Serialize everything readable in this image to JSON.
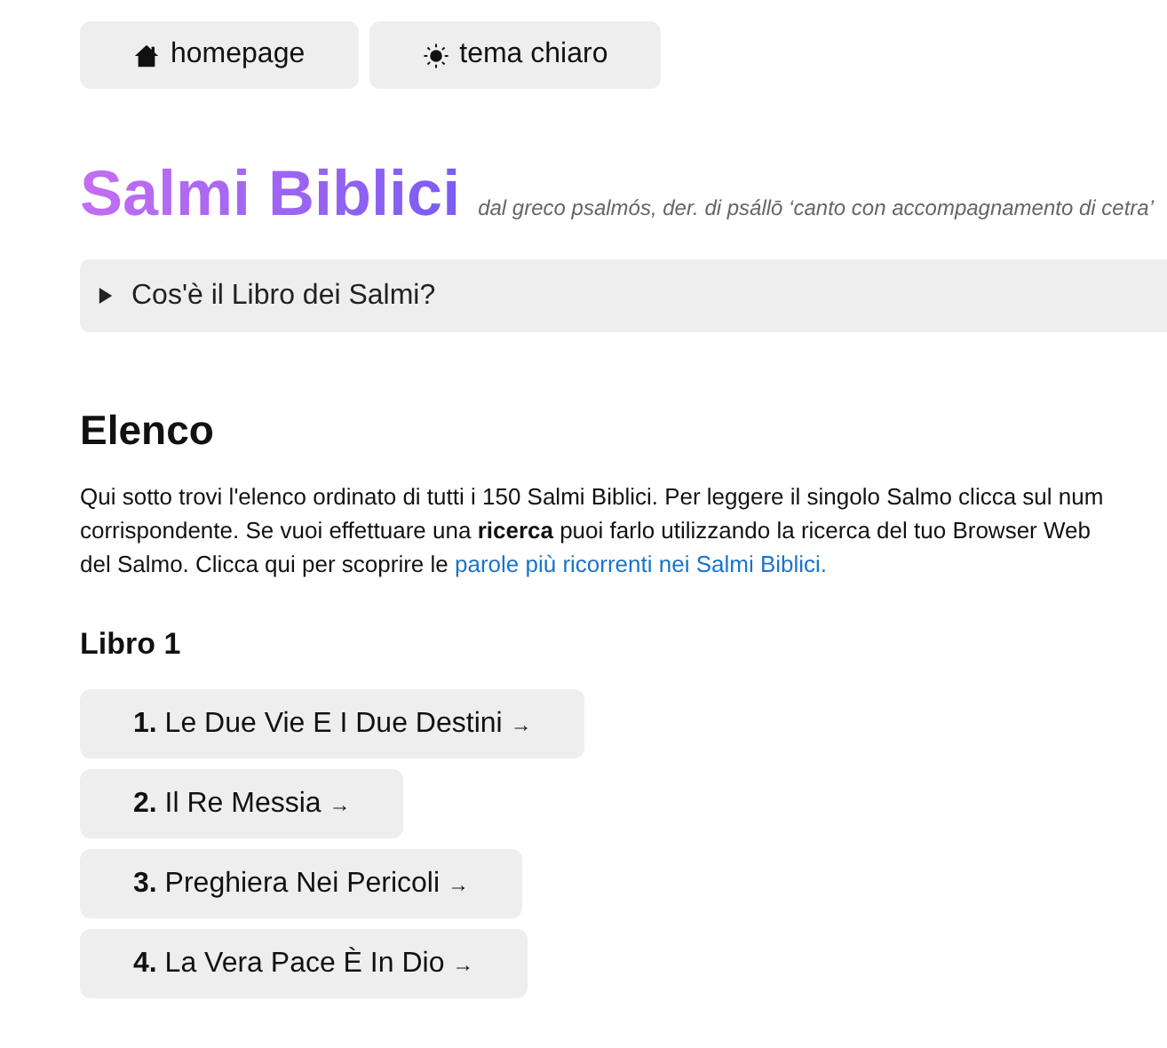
{
  "nav": [
    {
      "kind": "home",
      "label": "homepage"
    },
    {
      "kind": "sun",
      "label": "tema chiaro"
    }
  ],
  "title": "Salmi Biblici",
  "subtitle": "dal greco psalmós, der. di psállō ‘canto con accompagnamento di cetra’",
  "details": {
    "summary": "Cos'è il Libro dei Salmi?",
    "expanded": false
  },
  "section_title": "Elenco",
  "intro": {
    "text": "Qui sotto trovi l'elenco ordinato di tutti i 150 Salmi Biblici. Per leggere il singolo Salmo clicca sul num\ncorrispondente. Se vuoi effettuare una **ricerca** puoi farlo utilizzando la ricerca del tuo Browser Web\ndel Salmo. Clicca qui per scoprire le ",
    "link": "parole più ricorrenti nei Salmi Biblici."
  },
  "book_title": "Libro 1",
  "psalms": [
    {
      "number": "1.",
      "title": "Le Due Vie E I Due Destini",
      "arrow": "→"
    },
    {
      "number": "2.",
      "title": "Il Re Messia",
      "arrow": "→"
    },
    {
      "number": "3.",
      "title": "Preghiera Nei Pericoli",
      "arrow": "→"
    },
    {
      "number": "4.",
      "title": "La Vera Pace È In Dio",
      "arrow": "→"
    }
  ]
}
